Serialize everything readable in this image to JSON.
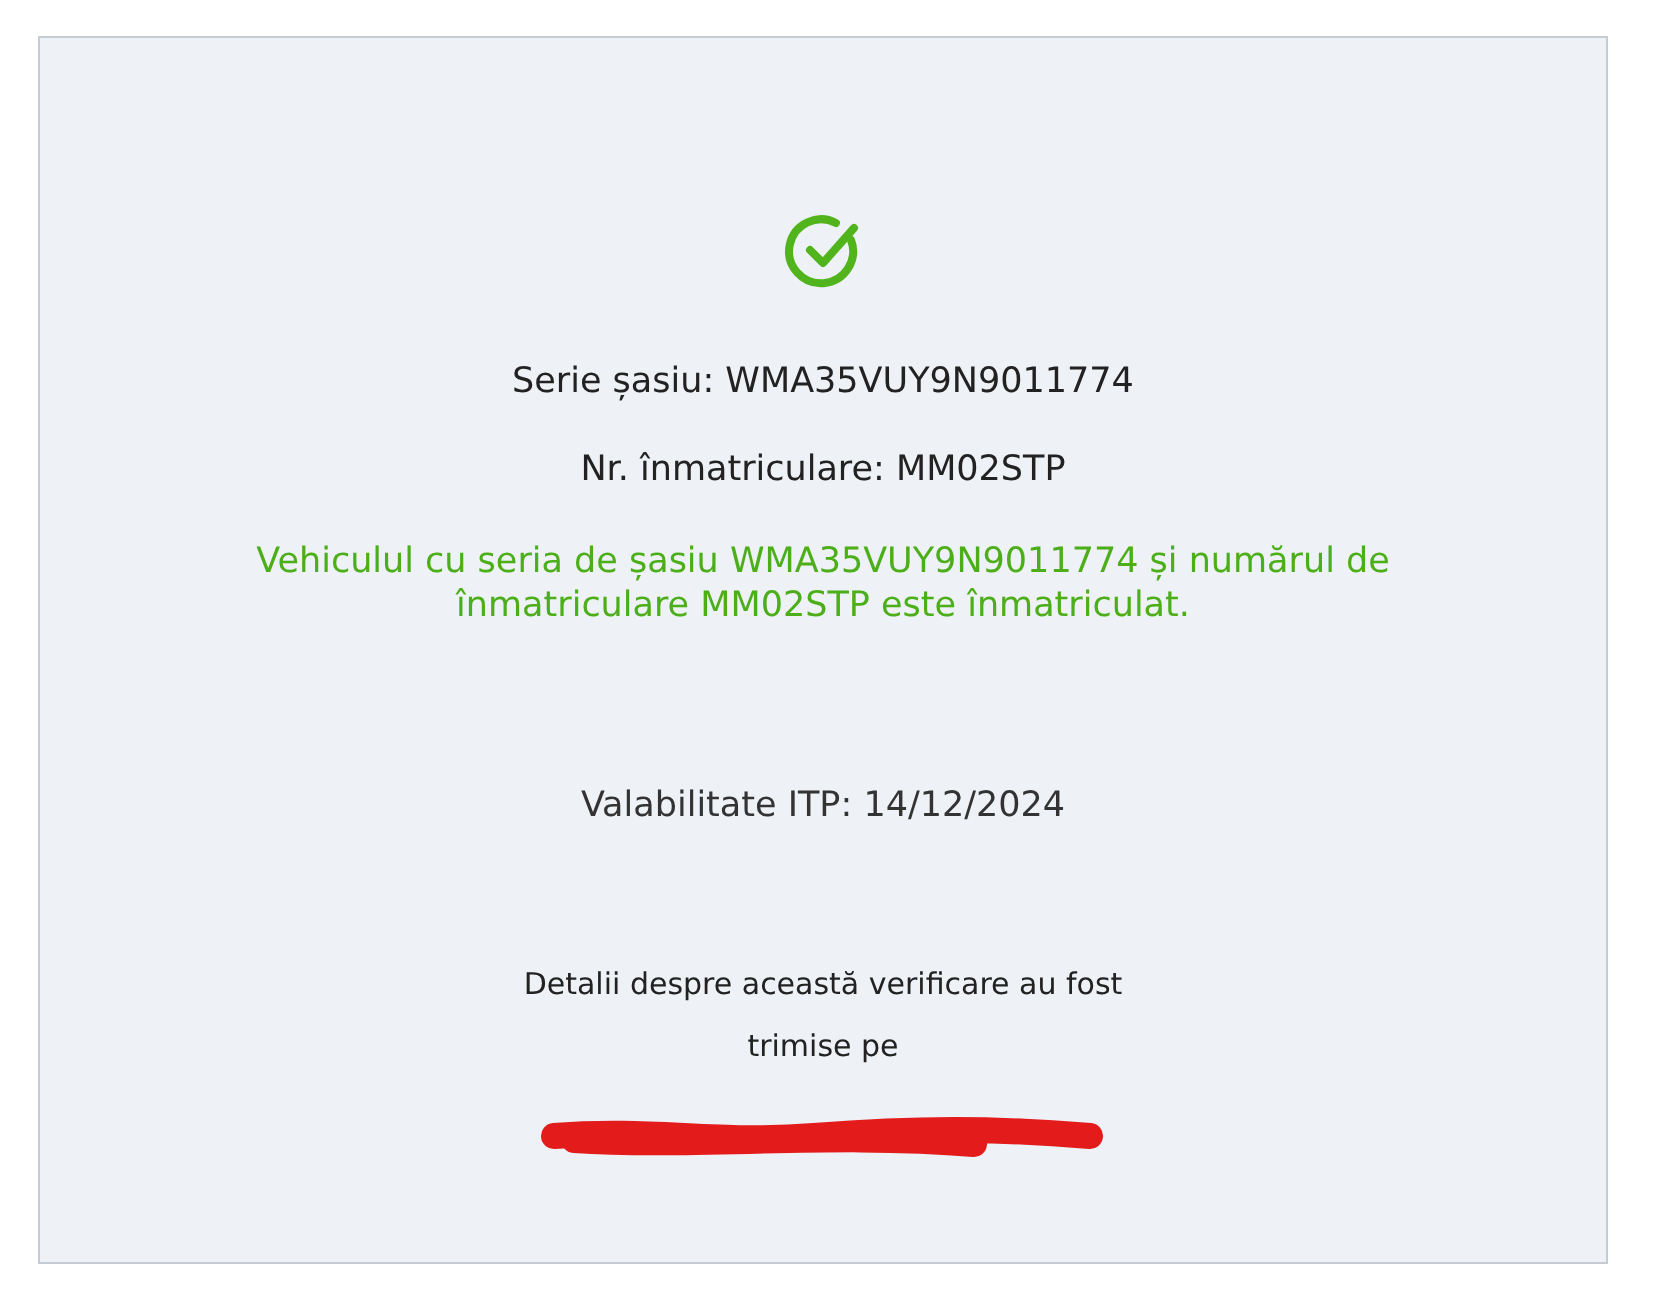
{
  "status": {
    "kind": "success"
  },
  "chassis": "Serie șasiu: WMA35VUY9N9011774",
  "plate": "Nr. înmatriculare: MM02STP",
  "message": "Vehiculul cu seria de șasiu WMA35VUY9N9011774 și numărul de înmatriculare MM02STP este înmatriculat.",
  "itp": "Valabilitate ITP: 14/12/2024",
  "details": "Detalii despre această verificare au fost trimise pe"
}
